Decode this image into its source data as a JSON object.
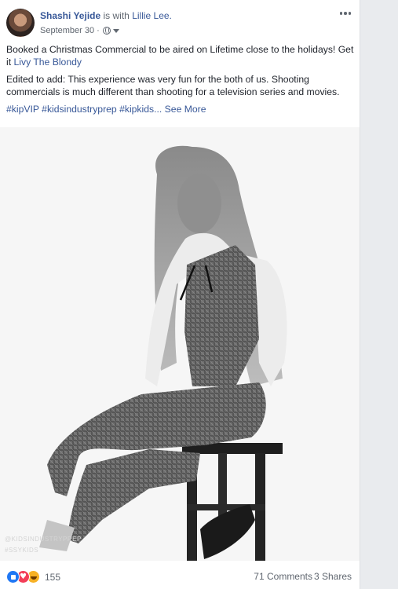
{
  "post": {
    "author": "Shashi Yejide",
    "with_text": "is with",
    "with_name": "Lillie Lee.",
    "date": "September 30",
    "dot": "·",
    "privacy_icon": "globe-icon",
    "menu_icon": "more-options-icon"
  },
  "body": {
    "p1_text": "Booked a Christmas Commercial to be aired on Lifetime close to the holidays! Get it ",
    "p1_link": "Livy The Blondy",
    "p2_text": "Edited to add: This experience was very fun for the both of us. Shooting commercials is much different than shooting for a television series and movies.",
    "hashtags": "#kipVIP #kidsindustryprep #kipkids...",
    "see_more": "See More"
  },
  "photo": {
    "watermark_1": "@KIDSINDUSTRYPREP",
    "watermark_2": "#SSYKIDS"
  },
  "footer": {
    "reaction_icons": [
      "like-icon",
      "love-icon",
      "haha-icon"
    ],
    "reaction_count": "155",
    "comments": "71 Comments",
    "shares": "3 Shares"
  }
}
